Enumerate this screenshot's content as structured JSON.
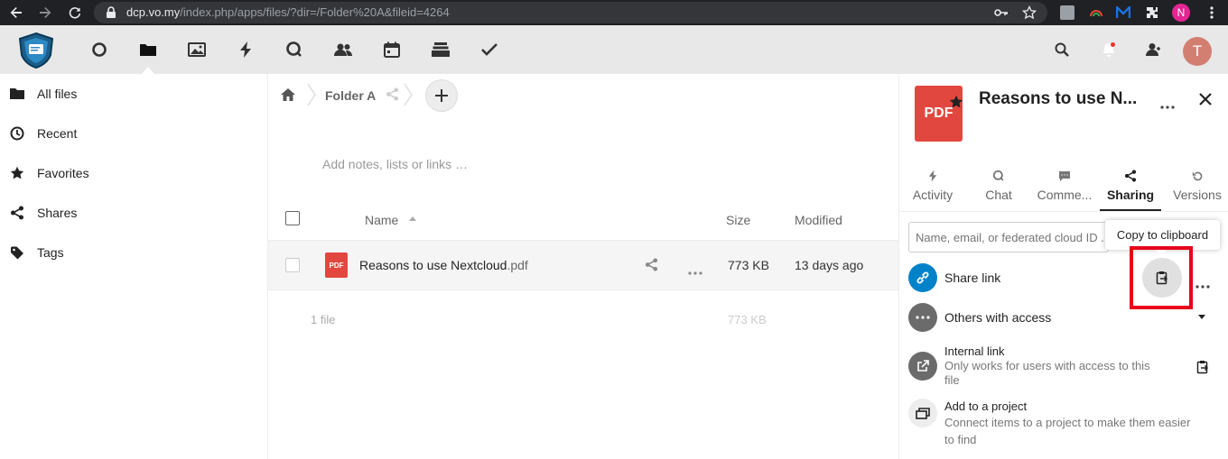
{
  "browser": {
    "url_host": "dcp.vo.my",
    "url_path": "/index.php/apps/files/?dir=/Folder%20A&fileid=4264",
    "profile_initial": "N"
  },
  "header": {
    "user_initial": "T"
  },
  "sidebar": {
    "items": [
      {
        "label": "All files"
      },
      {
        "label": "Recent"
      },
      {
        "label": "Favorites"
      },
      {
        "label": "Shares"
      },
      {
        "label": "Tags"
      }
    ]
  },
  "breadcrumb": {
    "folder": "Folder A"
  },
  "notes": {
    "placeholder": "Add notes, lists or links …"
  },
  "table": {
    "headers": {
      "name": "Name",
      "size": "Size",
      "modified": "Modified"
    },
    "rows": [
      {
        "icon_label": "PDF",
        "name": "Reasons to use Nextcloud",
        "ext": ".pdf",
        "size": "773 KB",
        "modified": "13 days ago"
      }
    ],
    "summary": {
      "count": "1 file",
      "size": "773 KB"
    }
  },
  "details": {
    "file_icon_label": "PDF",
    "title": "Reasons to use N...",
    "tabs": [
      {
        "label": "Activity"
      },
      {
        "label": "Chat"
      },
      {
        "label": "Comme..."
      },
      {
        "label": "Sharing"
      },
      {
        "label": "Versions"
      }
    ],
    "share_input_placeholder": "Name, email, or federated cloud ID ...",
    "tooltip": "Copy to clipboard",
    "share_link_label": "Share link",
    "others_label": "Others with access",
    "internal_link": {
      "title": "Internal link",
      "line1": "Only works for users with access to this",
      "line2": "file"
    },
    "project": {
      "title": "Add to a project",
      "line1": "Connect items to a project to make them easier",
      "line2": "to find"
    }
  },
  "colors": {
    "accent": "#0082c9",
    "pdf_red": "#e2473f",
    "highlight": "#e8001c"
  }
}
